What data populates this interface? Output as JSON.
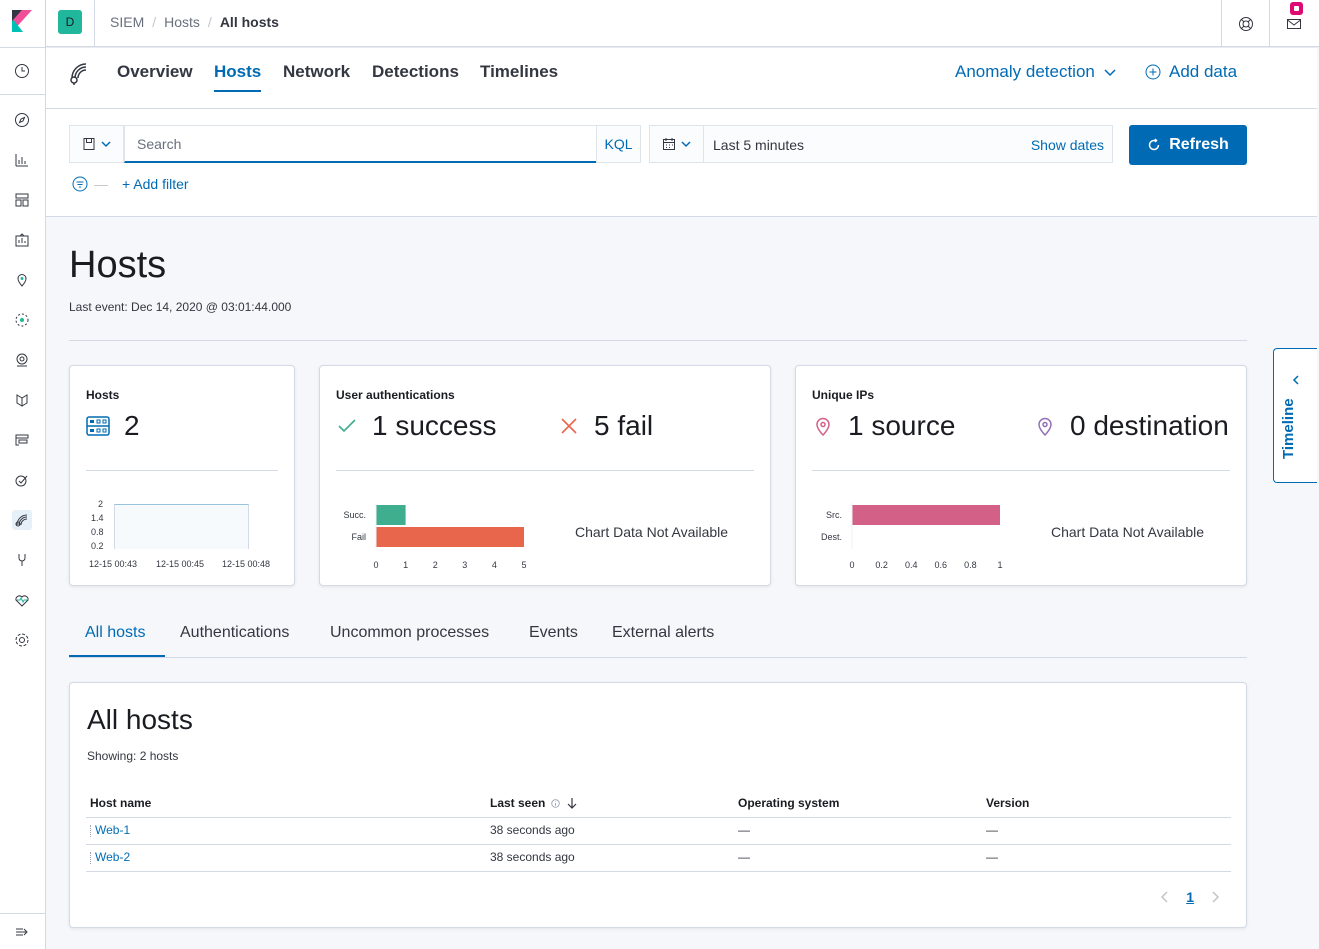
{
  "header": {
    "space_initial": "D",
    "breadcrumbs": [
      "SIEM",
      "Hosts",
      "All hosts"
    ],
    "breadcrumb_separator": "/"
  },
  "siem_nav": {
    "tabs": [
      "Overview",
      "Hosts",
      "Network",
      "Detections",
      "Timelines"
    ],
    "active_tab": "Hosts",
    "anomaly_detection_label": "Anomaly detection",
    "add_data_label": "Add data"
  },
  "query_bar": {
    "search_placeholder": "Search",
    "kql_label": "KQL",
    "date_range": "Last 5 minutes",
    "show_dates_label": "Show dates",
    "refresh_label": "Refresh",
    "add_filter_label": "+ Add filter",
    "filter_dash": "—"
  },
  "page": {
    "title": "Hosts",
    "last_event": "Last event: Dec 14, 2020 @ 03:01:44.000"
  },
  "cards": {
    "hosts": {
      "title": "Hosts",
      "value": "2",
      "y_ticks": [
        "2",
        "1.4",
        "0.8",
        "0.2"
      ],
      "x_ticks": [
        "12-15 00:43",
        "12-15 00:45",
        "12-15 00:48"
      ]
    },
    "auth": {
      "title": "User authentications",
      "success_label": "1 success",
      "fail_label": "5 fail",
      "chart_na": "Chart Data Not Available"
    },
    "ips": {
      "title": "Unique IPs",
      "source_label": "1 source",
      "dest_label": "0 destination",
      "chart_na": "Chart Data Not Available"
    }
  },
  "chart_data": [
    {
      "type": "bar",
      "orientation": "horizontal",
      "categories": [
        "Succ.",
        "Fail"
      ],
      "values": [
        1,
        5
      ],
      "colors": [
        "#3eae8e",
        "#e7664c"
      ],
      "xlim": [
        0,
        5
      ],
      "x_ticks": [
        "0",
        "1",
        "2",
        "3",
        "4",
        "5"
      ]
    },
    {
      "type": "bar",
      "orientation": "horizontal",
      "categories": [
        "Src.",
        "Dest."
      ],
      "values": [
        1,
        0
      ],
      "colors": [
        "#d36086",
        "#9170b8"
      ],
      "xlim": [
        0,
        1
      ],
      "x_ticks": [
        "0",
        "0.2",
        "0.4",
        "0.6",
        "0.8",
        "1"
      ]
    }
  ],
  "timeline_tab": {
    "label": "Timeline"
  },
  "subtabs": {
    "items": [
      "All hosts",
      "Authentications",
      "Uncommon processes",
      "Events",
      "External alerts"
    ],
    "active": "All hosts"
  },
  "hosts_table": {
    "title": "All hosts",
    "showing": "Showing: 2 hosts",
    "columns": [
      "Host name",
      "Last seen",
      "Operating system",
      "Version"
    ],
    "rows": [
      {
        "host": "Web-1",
        "last_seen": "38 seconds ago",
        "os": "—",
        "version": "—"
      },
      {
        "host": "Web-2",
        "last_seen": "38 seconds ago",
        "os": "—",
        "version": "—"
      }
    ],
    "page": "1"
  },
  "colors": {
    "primary": "#006bb4",
    "success": "#3eae8e",
    "danger": "#e7664c",
    "source": "#d36086",
    "destination": "#9170b8",
    "space_badge": "#20b79c"
  }
}
